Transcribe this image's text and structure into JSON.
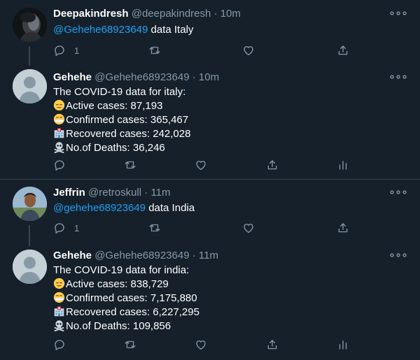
{
  "threads": [
    {
      "reply": {
        "name": "Deepakindresh",
        "handle": "@deepakindresh",
        "dot": "·",
        "time": "10m",
        "mention": "@Gehehe68923649",
        "text": " data Italy",
        "reply_count": "1"
      },
      "bot": {
        "name": "Gehehe",
        "handle": "@Gehehe68923649",
        "dot": "·",
        "time": "10m",
        "lines": [
          "The COVID-19 data for italy:",
          "Active cases: 87,193",
          "Confirmed cases: 365,467",
          "Recovered cases: 242,028",
          "No.of Deaths: 36,246"
        ]
      }
    },
    {
      "reply": {
        "name": "Jeffrin",
        "handle": "@retroskull",
        "dot": "·",
        "time": "11m",
        "mention": "@gehehe68923649",
        "text": " data India",
        "reply_count": "1"
      },
      "bot": {
        "name": "Gehehe",
        "handle": "@Gehehe68923649",
        "dot": "·",
        "time": "11m",
        "lines": [
          "The COVID-19 data for india:",
          "Active cases: 838,729",
          "Confirmed cases: 7,175,880",
          "Recovered cases: 6,227,295",
          "No.of Deaths: 109,856"
        ]
      }
    }
  ],
  "icons": {
    "more": "more-icon",
    "reply": "reply-icon",
    "retweet": "retweet-icon",
    "like": "like-icon",
    "share": "share-icon",
    "analytics": "analytics-icon"
  },
  "colors": {
    "background": "#15202b",
    "accent": "#1da1f2",
    "muted": "#8899a6",
    "divider": "#38444d"
  }
}
